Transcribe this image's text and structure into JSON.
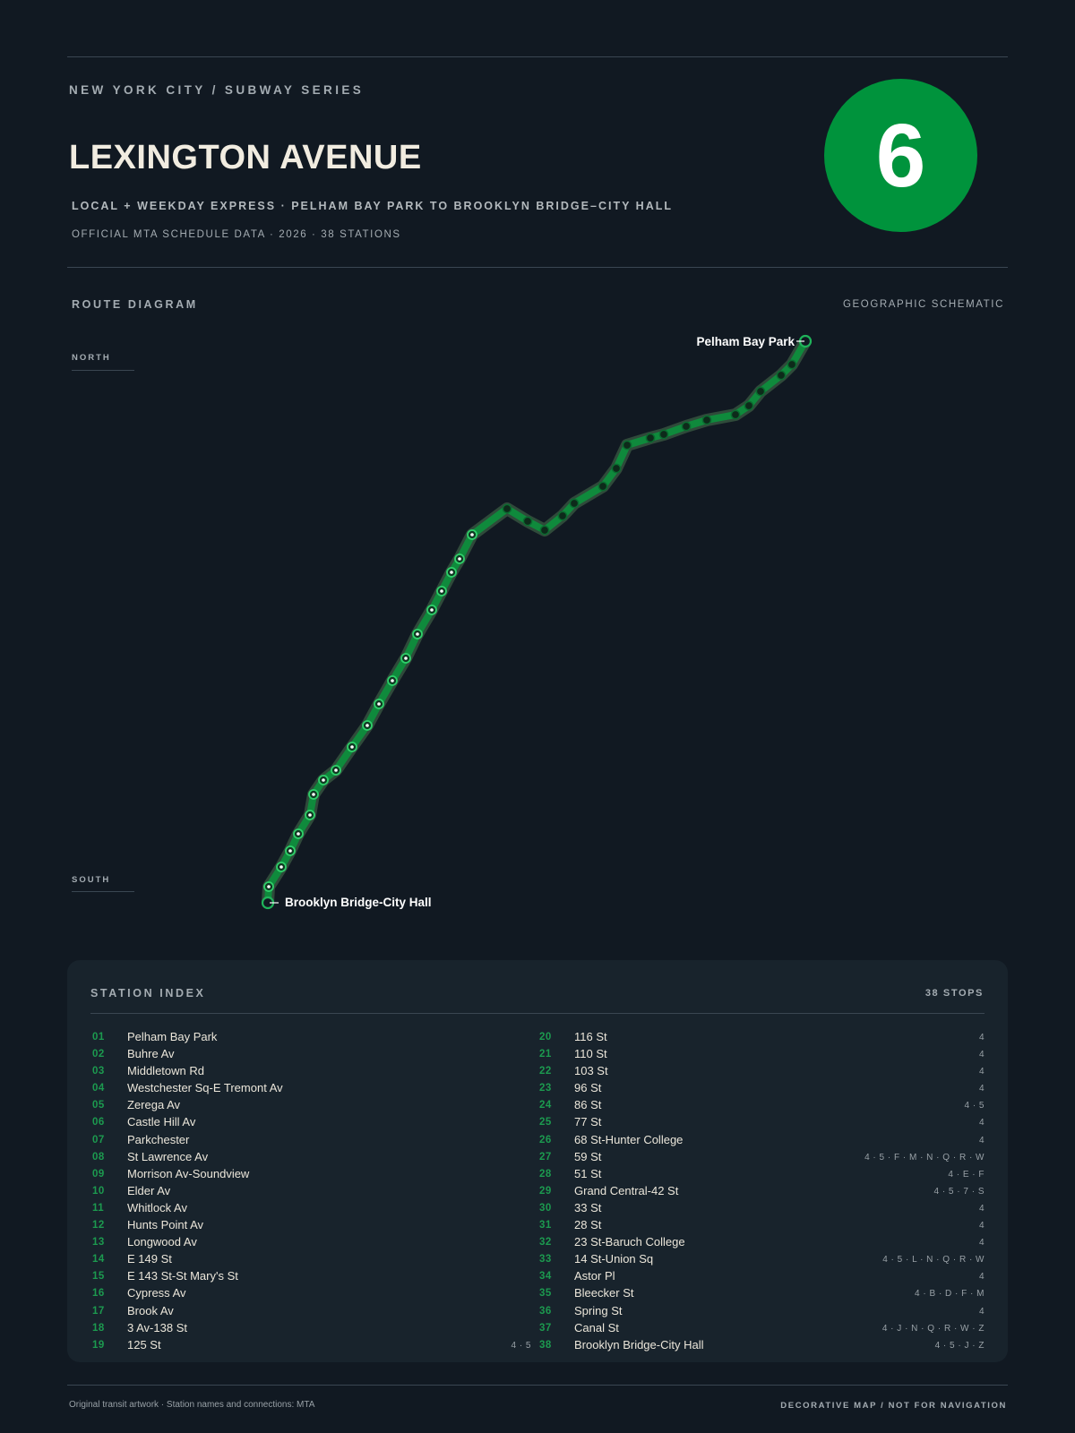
{
  "header": {
    "kicker": "NEW YORK CITY / SUBWAY SERIES",
    "title": "LEXINGTON AVENUE",
    "subtitle": "LOCAL + WEEKDAY EXPRESS · PELHAM BAY PARK TO BROOKLYN BRIDGE–CITY HALL",
    "meta": "OFFICIAL MTA SCHEDULE DATA · 2026 · 38 STATIONS",
    "route_bullet": "6",
    "route_color": "#00933c"
  },
  "diagram": {
    "label": "ROUTE DIAGRAM",
    "right_label": "GEOGRAPHIC SCHEMATIC",
    "north_label": "NORTH",
    "south_label": "SOUTH",
    "north_terminal": "Pelham Bay Park",
    "south_terminal": "Brooklyn Bridge-City Hall"
  },
  "index": {
    "title": "STATION INDEX",
    "count": "38 STOPS",
    "stations": [
      {
        "num": "01",
        "name": "Pelham Bay Park",
        "conn": ""
      },
      {
        "num": "02",
        "name": "Buhre Av",
        "conn": ""
      },
      {
        "num": "03",
        "name": "Middletown Rd",
        "conn": ""
      },
      {
        "num": "04",
        "name": "Westchester Sq-E Tremont Av",
        "conn": ""
      },
      {
        "num": "05",
        "name": "Zerega Av",
        "conn": ""
      },
      {
        "num": "06",
        "name": "Castle Hill Av",
        "conn": ""
      },
      {
        "num": "07",
        "name": "Parkchester",
        "conn": ""
      },
      {
        "num": "08",
        "name": "St Lawrence Av",
        "conn": ""
      },
      {
        "num": "09",
        "name": "Morrison Av-Soundview",
        "conn": ""
      },
      {
        "num": "10",
        "name": "Elder Av",
        "conn": ""
      },
      {
        "num": "11",
        "name": "Whitlock Av",
        "conn": ""
      },
      {
        "num": "12",
        "name": "Hunts Point Av",
        "conn": ""
      },
      {
        "num": "13",
        "name": "Longwood Av",
        "conn": ""
      },
      {
        "num": "14",
        "name": "E 149 St",
        "conn": ""
      },
      {
        "num": "15",
        "name": "E 143 St-St Mary's St",
        "conn": ""
      },
      {
        "num": "16",
        "name": "Cypress Av",
        "conn": ""
      },
      {
        "num": "17",
        "name": "Brook Av",
        "conn": ""
      },
      {
        "num": "18",
        "name": "3 Av-138 St",
        "conn": ""
      },
      {
        "num": "19",
        "name": "125 St",
        "conn": "4 · 5"
      },
      {
        "num": "20",
        "name": "116 St",
        "conn": "4"
      },
      {
        "num": "21",
        "name": "110 St",
        "conn": "4"
      },
      {
        "num": "22",
        "name": "103 St",
        "conn": "4"
      },
      {
        "num": "23",
        "name": "96 St",
        "conn": "4"
      },
      {
        "num": "24",
        "name": "86 St",
        "conn": "4 · 5"
      },
      {
        "num": "25",
        "name": "77 St",
        "conn": "4"
      },
      {
        "num": "26",
        "name": "68 St-Hunter College",
        "conn": "4"
      },
      {
        "num": "27",
        "name": "59 St",
        "conn": "4 · 5 · F · M · N · Q · R · W"
      },
      {
        "num": "28",
        "name": "51 St",
        "conn": "4 · E · F"
      },
      {
        "num": "29",
        "name": "Grand Central-42 St",
        "conn": "4 · 5 · 7 · S"
      },
      {
        "num": "30",
        "name": "33 St",
        "conn": "4"
      },
      {
        "num": "31",
        "name": "28 St",
        "conn": "4"
      },
      {
        "num": "32",
        "name": "23 St-Baruch College",
        "conn": "4"
      },
      {
        "num": "33",
        "name": "14 St-Union Sq",
        "conn": "4 · 5 · L · N · Q · R · W"
      },
      {
        "num": "34",
        "name": "Astor Pl",
        "conn": "4"
      },
      {
        "num": "35",
        "name": "Bleecker St",
        "conn": "4 · B · D · F · M"
      },
      {
        "num": "36",
        "name": "Spring St",
        "conn": "4"
      },
      {
        "num": "37",
        "name": "Canal St",
        "conn": "4 · J · N · Q · R · W · Z"
      },
      {
        "num": "38",
        "name": "Brooklyn Bridge-City Hall",
        "conn": "4 · 5 · J · Z"
      }
    ]
  },
  "footer": {
    "left": "Original transit artwork · Station names and connections: MTA",
    "right": "DECORATIVE MAP / NOT FOR NAVIGATION"
  }
}
